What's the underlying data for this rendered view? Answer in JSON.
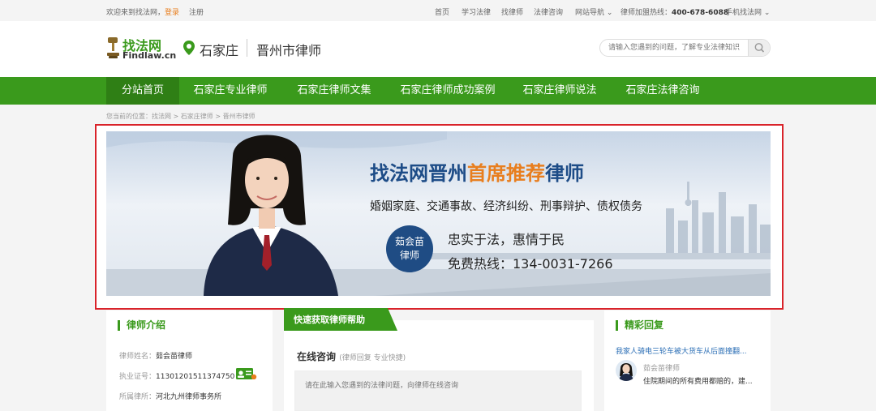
{
  "topbar": {
    "welcome": "欢迎来到找法网，",
    "login": "登录",
    "register": "注册",
    "links": [
      "首页",
      "学习法律",
      "找律师",
      "法律咨询",
      "网站导航"
    ],
    "hotline_label": "律师加盟热线：",
    "hotline": "400-678-6088",
    "mobile": "手机找法网"
  },
  "header": {
    "logo_cn": "找法网",
    "logo_en": "Findlaw.cn",
    "city": "石家庄",
    "subcity": "晋州市律师",
    "search_placeholder": "请输入您遇到的问题，了解专业法律知识"
  },
  "nav": {
    "items": [
      "分站首页",
      "石家庄专业律师",
      "石家庄律师文集",
      "石家庄律师成功案例",
      "石家庄律师说法",
      "石家庄法律咨询"
    ]
  },
  "breadcrumb": "您当前的位置：找法网 > 石家庄律师 > 晋州市律师",
  "banner": {
    "title_a": "找法网晋州",
    "title_b": "首席推荐",
    "title_c": "律师",
    "areas": "婚姻家庭、交通事故、经济纠纷、刑事辩护、债权债务",
    "name_line1": "茹会苗",
    "name_line2": "律师",
    "slogan": "忠实于法，惠情于民",
    "hotline": "免费热线：134-0031-7266"
  },
  "intro": {
    "title": "律师介绍",
    "name_label": "律师姓名：",
    "name": "茹会苗律师",
    "license_label": "执业证号：",
    "license": "11301201511374750",
    "firm_label": "所属律所：",
    "firm": "河北九州律师事务所"
  },
  "consult": {
    "tab": "快速获取律师帮助",
    "title": "在线咨询",
    "subtitle": "(律师回复 专业快捷)",
    "placeholder": "请在此输入您遇到的法律问题，向律师在线咨询"
  },
  "replies": {
    "title": "精彩回复",
    "link": "我家人骑电三轮车被大货车从后面撞翻...",
    "lawyer": "茹会苗律师",
    "text": "住院期间的所有费用都赔的，建..."
  },
  "colors": {
    "brand_green": "#3a9a1c",
    "highlight_red": "#d9232a",
    "banner_blue": "#1d4c87",
    "banner_orange": "#e87e1e"
  }
}
